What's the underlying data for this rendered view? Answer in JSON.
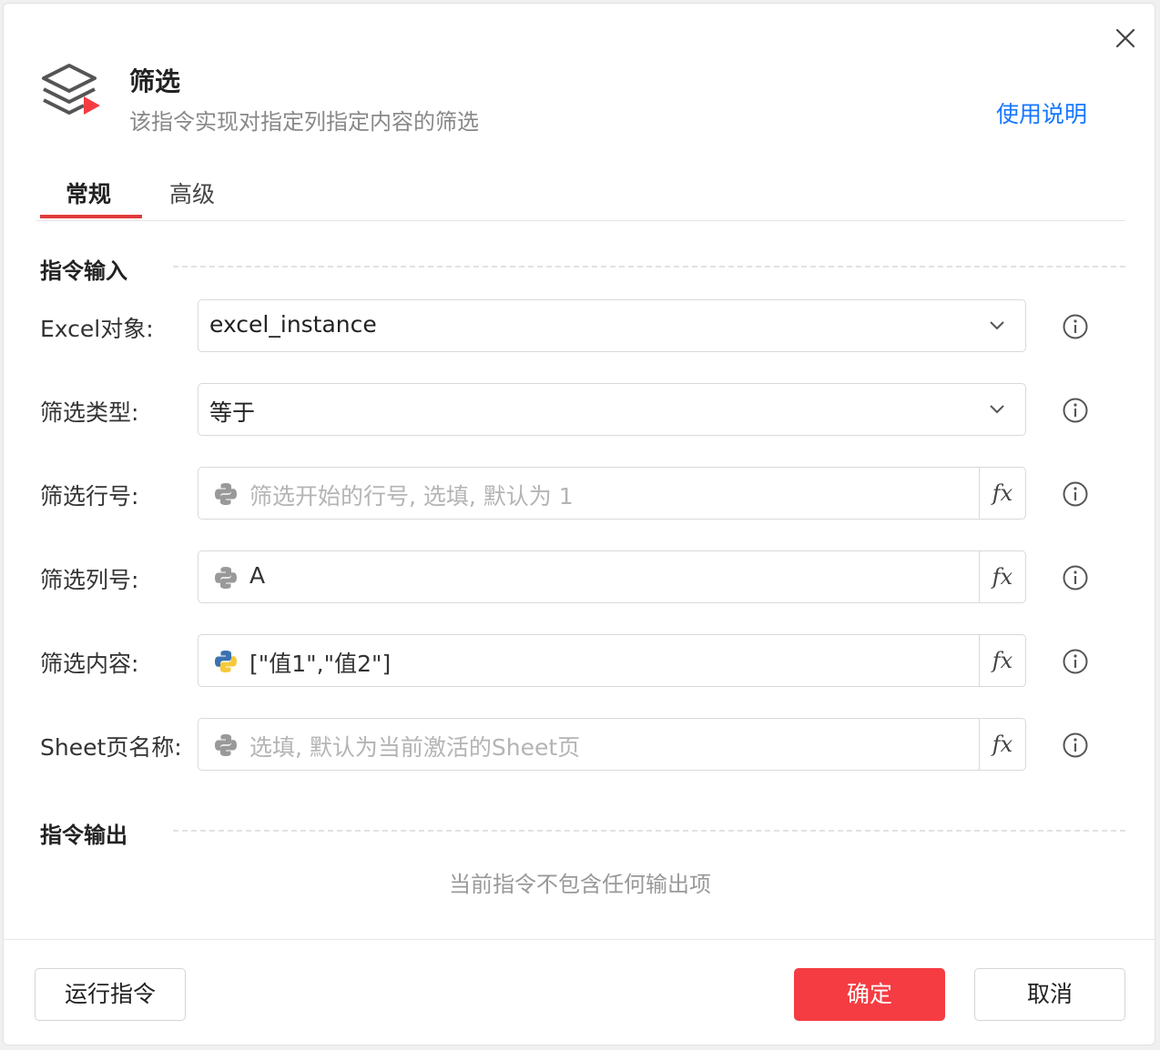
{
  "header": {
    "title": "筛选",
    "subtitle": "该指令实现对指定列指定内容的筛选",
    "help_link": "使用说明"
  },
  "tabs": [
    {
      "label": "常规",
      "active": true
    },
    {
      "label": "高级",
      "active": false
    }
  ],
  "sections": {
    "input_title": "指令输入",
    "output_title": "指令输出",
    "output_empty": "当前指令不包含任何输出项"
  },
  "fields": {
    "excel_object": {
      "label": "Excel对象:",
      "value": "excel_instance"
    },
    "filter_type": {
      "label": "筛选类型:",
      "value": "等于"
    },
    "filter_row": {
      "label": "筛选行号:",
      "value": "",
      "placeholder": "筛选开始的行号, 选填, 默认为 1"
    },
    "filter_column": {
      "label": "筛选列号:",
      "value": "A"
    },
    "filter_content": {
      "label": "筛选内容:",
      "value": "[\"值1\",\"值2\"]"
    },
    "sheet_name": {
      "label": "Sheet页名称:",
      "value": "",
      "placeholder": "选填, 默认为当前激活的Sheet页"
    }
  },
  "fx_label": "fx",
  "buttons": {
    "run": "运行指令",
    "ok": "确定",
    "cancel": "取消"
  },
  "colors": {
    "accent_red": "#f53c42",
    "link_blue": "#1677ff",
    "tab_underline": "#e23b3b"
  },
  "icons": {
    "close": "close-icon",
    "header": "stack-layers-icon",
    "dropdown": "chevron-down-icon",
    "python": "python-icon",
    "info": "info-circle-icon"
  }
}
